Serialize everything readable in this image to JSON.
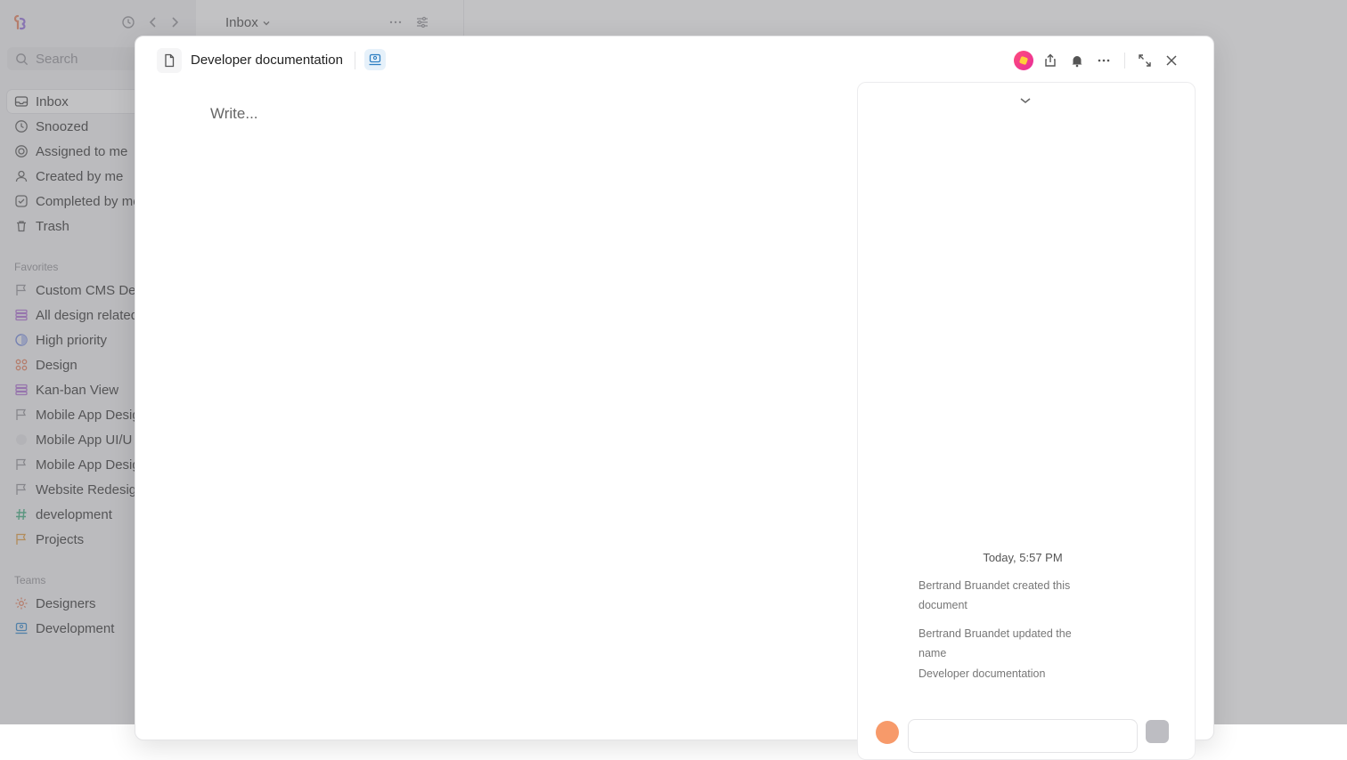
{
  "sidebar": {
    "search_placeholder": "Search",
    "nav": [
      {
        "label": "Inbox",
        "icon": "inbox-icon"
      },
      {
        "label": "Snoozed",
        "icon": "clock-icon"
      },
      {
        "label": "Assigned to me",
        "icon": "target-icon"
      },
      {
        "label": "Created by me",
        "icon": "user-icon"
      },
      {
        "label": "Completed by me",
        "icon": "check-square-icon"
      },
      {
        "label": "Trash",
        "icon": "trash-icon"
      }
    ],
    "favorites_label": "Favorites",
    "favorites": [
      {
        "label": "Custom CMS Dev",
        "icon": "flag-icon",
        "color": "#9a9a9f"
      },
      {
        "label": "All design related",
        "icon": "stack-icon",
        "color": "#b57ad8"
      },
      {
        "label": "High priority",
        "icon": "circle-icon",
        "color": "#7a8fe0"
      },
      {
        "label": "Design",
        "icon": "grid-icon",
        "color": "#e98a6a"
      },
      {
        "label": "Kan-ban View",
        "icon": "stack-icon",
        "color": "#b57ad8"
      },
      {
        "label": "Mobile App Desig",
        "icon": "flag-icon",
        "color": "#9a9a9f"
      },
      {
        "label": "Mobile App UI/U",
        "icon": "circle-icon",
        "color": "#d0d0d4"
      },
      {
        "label": "Mobile App Desig",
        "icon": "flag-icon",
        "color": "#9a9a9f"
      },
      {
        "label": "Website Redesig",
        "icon": "flag-icon",
        "color": "#9a9a9f"
      },
      {
        "label": "development",
        "icon": "hash-icon",
        "color": "#4fb38a"
      },
      {
        "label": "Projects",
        "icon": "flag-icon",
        "color": "#e3a24a"
      }
    ],
    "teams_label": "Teams",
    "teams": [
      {
        "label": "Designers",
        "icon": "gear-icon",
        "color": "#e98a6a"
      },
      {
        "label": "Development",
        "icon": "monitor-icon",
        "color": "#3f8fd0"
      }
    ]
  },
  "list_header": {
    "title": "Inbox"
  },
  "modal": {
    "title": "Developer documentation",
    "placeholder": "Write...",
    "activity": {
      "time": "Today, 5:57 PM",
      "entries": [
        "Bertrand Bruandet created this document",
        "Bertrand Bruandet updated the name",
        "Developer documentation"
      ]
    }
  }
}
